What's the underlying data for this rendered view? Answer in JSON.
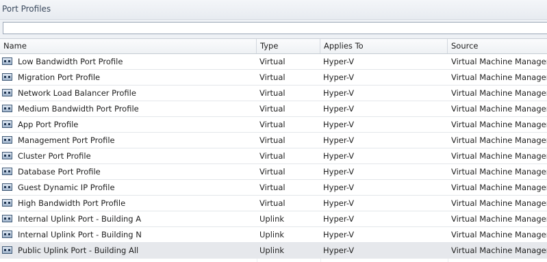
{
  "window": {
    "title": "Port Profiles"
  },
  "filter": {
    "value": "",
    "placeholder": ""
  },
  "grid": {
    "columns": [
      "Name",
      "Type",
      "Applies To",
      "Source"
    ],
    "rows": [
      {
        "name": "Low Bandwidth Port Profile",
        "type": "Virtual",
        "applies_to": "Hyper-V",
        "source": "Virtual Machine Manager",
        "icon": "port-profile-icon"
      },
      {
        "name": "Migration Port Profile",
        "type": "Virtual",
        "applies_to": "Hyper-V",
        "source": "Virtual Machine Manager",
        "icon": "port-profile-icon"
      },
      {
        "name": "Network Load Balancer Profile",
        "type": "Virtual",
        "applies_to": "Hyper-V",
        "source": "Virtual Machine Manager",
        "icon": "port-profile-icon"
      },
      {
        "name": "Medium Bandwidth Port Profile",
        "type": "Virtual",
        "applies_to": "Hyper-V",
        "source": "Virtual Machine Manager",
        "icon": "port-profile-icon"
      },
      {
        "name": "App Port Profile",
        "type": "Virtual",
        "applies_to": "Hyper-V",
        "source": "Virtual Machine Manager",
        "icon": "port-profile-icon"
      },
      {
        "name": "Management Port Profile",
        "type": "Virtual",
        "applies_to": "Hyper-V",
        "source": "Virtual Machine Manager",
        "icon": "port-profile-icon"
      },
      {
        "name": "Cluster Port Profile",
        "type": "Virtual",
        "applies_to": "Hyper-V",
        "source": "Virtual Machine Manager",
        "icon": "port-profile-icon"
      },
      {
        "name": "Database Port Profile",
        "type": "Virtual",
        "applies_to": "Hyper-V",
        "source": "Virtual Machine Manager",
        "icon": "port-profile-icon"
      },
      {
        "name": "Guest Dynamic IP Profile",
        "type": "Virtual",
        "applies_to": "Hyper-V",
        "source": "Virtual Machine Manager",
        "icon": "port-profile-icon"
      },
      {
        "name": "High Bandwidth Port Profile",
        "type": "Virtual",
        "applies_to": "Hyper-V",
        "source": "Virtual Machine Manager",
        "icon": "port-profile-icon"
      },
      {
        "name": "Internal Uplink Port - Building A",
        "type": "Uplink",
        "applies_to": "Hyper-V",
        "source": "Virtual Machine Manager",
        "icon": "port-profile-icon"
      },
      {
        "name": "Internal Uplink Port - Building N",
        "type": "Uplink",
        "applies_to": "Hyper-V",
        "source": "Virtual Machine Manager",
        "icon": "port-profile-icon"
      },
      {
        "name": "Public Uplink Port - Building All",
        "type": "Uplink",
        "applies_to": "Hyper-V",
        "source": "Virtual Machine Manager",
        "icon": "port-profile-icon",
        "selected": true
      }
    ]
  },
  "colors": {
    "selected_row": "#e6e8ec",
    "header_text": "#3b4a5e"
  }
}
